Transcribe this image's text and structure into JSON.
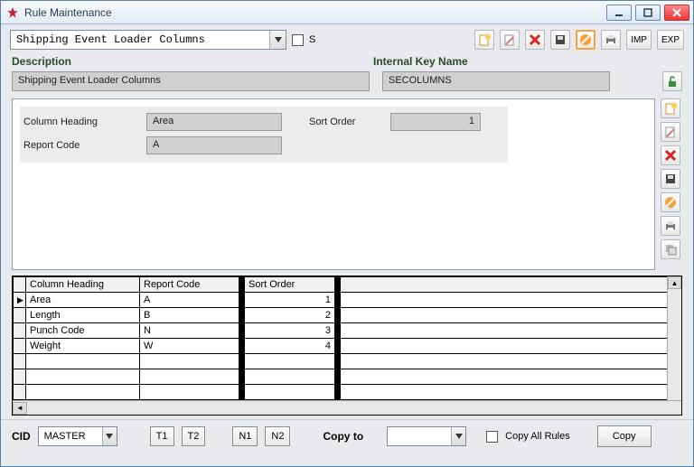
{
  "window": {
    "title": "Rule Maintenance"
  },
  "selector": {
    "value": "Shipping Event Loader Columns",
    "s_label": "S"
  },
  "toolbar": {
    "imp": "IMP",
    "exp": "EXP"
  },
  "labels": {
    "description": "Description",
    "internal_key": "Internal Key Name",
    "column_heading": "Column Heading",
    "report_code": "Report Code",
    "sort_order": "Sort Order",
    "cid": "CID",
    "copy_to": "Copy to",
    "copy_all": "Copy All Rules",
    "copy": "Copy",
    "t1": "T1",
    "t2": "T2",
    "n1": "N1",
    "n2": "N2"
  },
  "header_fields": {
    "description_value": "Shipping Event Loader Columns",
    "internal_key_value": "SECOLUMNS"
  },
  "detail": {
    "column_heading": "Area",
    "report_code": "A",
    "sort_order": "1"
  },
  "grid": {
    "columns": [
      "Column Heading",
      "Report Code",
      "Sort Order"
    ],
    "rows": [
      {
        "column_heading": "Area",
        "report_code": "A",
        "sort_order": "1",
        "selected": true
      },
      {
        "column_heading": "Length",
        "report_code": "B",
        "sort_order": "2",
        "selected": false
      },
      {
        "column_heading": "Punch Code",
        "report_code": "N",
        "sort_order": "3",
        "selected": false
      },
      {
        "column_heading": "Weight",
        "report_code": "W",
        "sort_order": "4",
        "selected": false
      }
    ]
  },
  "footer": {
    "cid_value": "MASTER",
    "copy_to_value": ""
  }
}
